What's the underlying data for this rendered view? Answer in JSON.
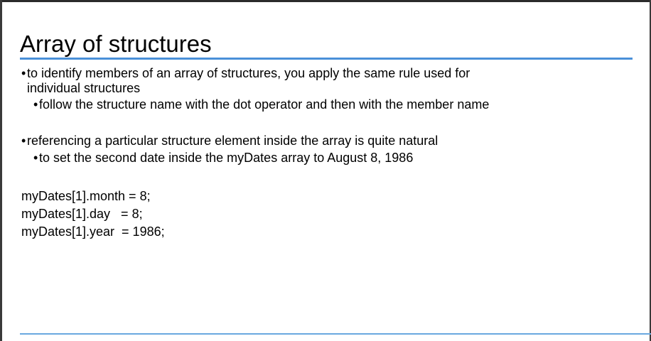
{
  "slide": {
    "title": "Array of structures",
    "bullets": [
      {
        "text": "to identify members of an array of structures, you apply the same rule used for"
      },
      {
        "text": "individual structures"
      },
      {
        "text": "follow the structure name with the dot operator and then with the member name"
      },
      {
        "text": "referencing a particular structure element inside the array is quite natural"
      },
      {
        "text": "to set the second date inside the myDates array to August 8, 1986"
      }
    ],
    "bullet_glyph": "•",
    "code": [
      "myDates[1].month = 8;",
      "myDates[1].day   = 8;",
      "myDates[1].year  = 1986;"
    ]
  },
  "colors": {
    "accent_rule": "#4a90d9",
    "footer_rule": "#6aa8e0"
  }
}
